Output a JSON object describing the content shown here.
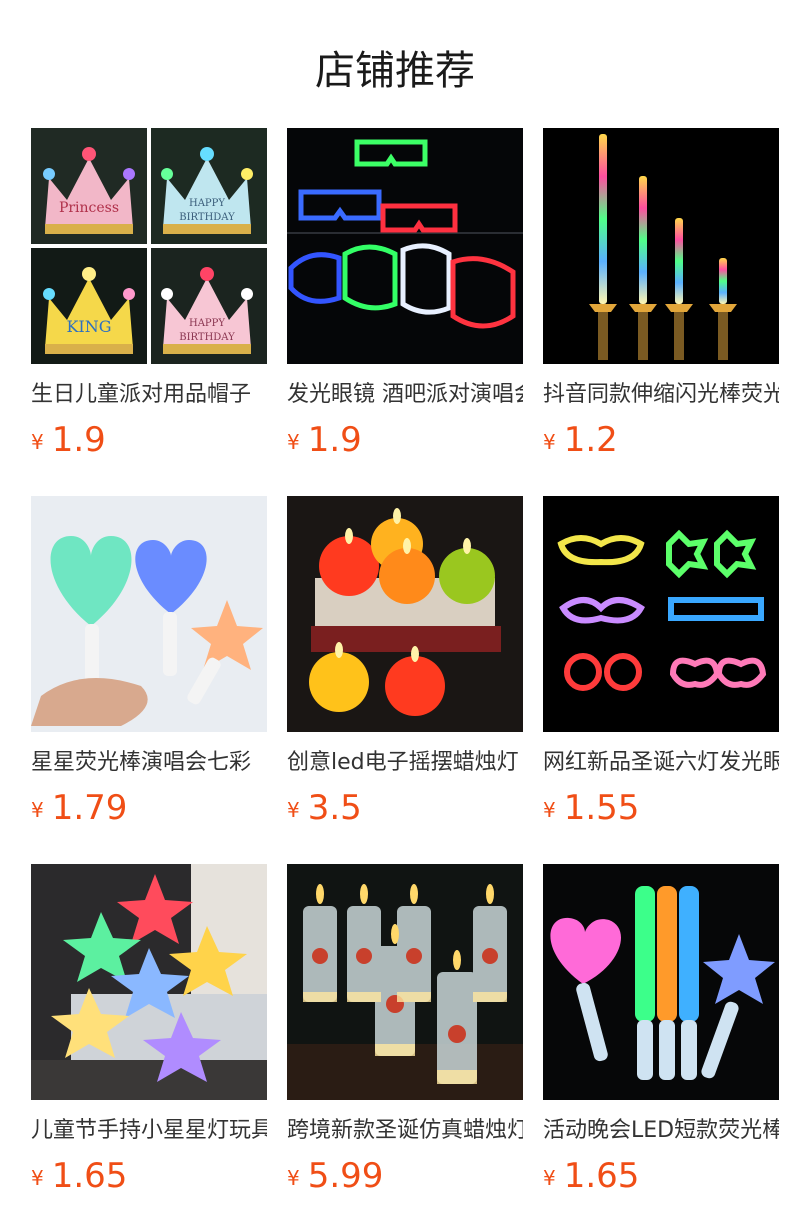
{
  "header": {
    "title": "店铺推荐"
  },
  "currency_symbol": "¥",
  "accent_color": "#f04e16",
  "products": [
    {
      "name": "生日儿童派对用品帽子",
      "price": "1.9",
      "image": "glowing-crown-image"
    },
    {
      "name": "发光眼镜 酒吧派对演唱会",
      "price": "1.9",
      "image": "glowing-glasses-image"
    },
    {
      "name": "抖音同款伸缩闪光棒荧光",
      "price": "1.2",
      "image": "telescopic-glow-stick-image"
    },
    {
      "name": "星星荧光棒演唱会七彩",
      "price": "1.79",
      "image": "heart-star-wands-image"
    },
    {
      "name": "创意led电子摇摆蜡烛灯",
      "price": "3.5",
      "image": "led-candles-image"
    },
    {
      "name": "网红新品圣诞六灯发光眼镜",
      "price": "1.55",
      "image": "party-glasses-image"
    },
    {
      "name": "儿童节手持小星星灯玩具",
      "price": "1.65",
      "image": "star-lamps-image"
    },
    {
      "name": "跨境新款圣诞仿真蜡烛灯",
      "price": "5.99",
      "image": "christmas-candles-image"
    },
    {
      "name": "活动晚会LED短款荧光棒",
      "price": "1.65",
      "image": "led-glow-wands-image"
    }
  ]
}
